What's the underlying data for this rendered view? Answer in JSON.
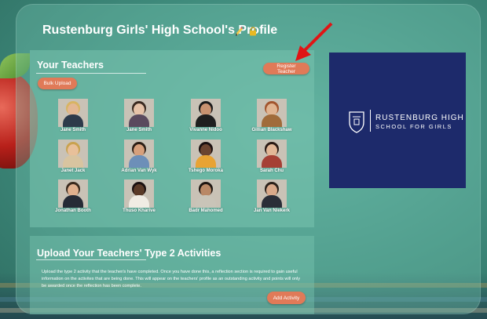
{
  "header": {
    "school_title": "Rustenburg Girls' High School's Profile",
    "icons": [
      "pencil-icon",
      "lock-icon"
    ]
  },
  "teachers": {
    "heading": "Your Teachers",
    "bulk_upload_label": "Bulk Upload",
    "register_label": "Register Teacher",
    "list": [
      {
        "name": "Jane Smith",
        "skin": "#e3b793",
        "shirt": "#2d3a4a",
        "hair": "#d8b463"
      },
      {
        "name": "Jane Smith",
        "skin": "#e6c3a8",
        "shirt": "#5a4a5e",
        "hair": "#3a2a20"
      },
      {
        "name": "Vivanne Nidoo",
        "skin": "#c89270",
        "shirt": "#1f1f1f",
        "hair": "#1a1a1a"
      },
      {
        "name": "Gillian Blackshaw",
        "skin": "#e1b592",
        "shirt": "#a06b3a",
        "hair": "#a2552e"
      },
      {
        "name": "Janet Jack",
        "skin": "#e8c09a",
        "shirt": "#d8c4a0",
        "hair": "#c9a24f"
      },
      {
        "name": "Adrian Van Wyk",
        "skin": "#d7a07c",
        "shirt": "#6d8fb8",
        "hair": "#2c1e15"
      },
      {
        "name": "Tshego Moroka",
        "skin": "#6b4430",
        "shirt": "#e8a334",
        "hair": "#1a1010"
      },
      {
        "name": "Sarah Chu",
        "skin": "#e2b797",
        "shirt": "#a54035",
        "hair": "#2a1a14"
      },
      {
        "name": "Jonathan Booth",
        "skin": "#e0b08e",
        "shirt": "#262b36",
        "hair": "#3a2a1e"
      },
      {
        "name": "Thuso Kharive",
        "skin": "#5a3a28",
        "shirt": "#f0ece4",
        "hair": "#1a1010"
      },
      {
        "name": "Badr Mahomed",
        "skin": "#b98866",
        "shirt": "#c9c4b8",
        "hair": "#1e1612"
      },
      {
        "name": "Jan Van Niekerk",
        "skin": "#d9a98a",
        "shirt": "#2a2e38",
        "hair": "#2b211a"
      }
    ]
  },
  "logo": {
    "line1": "RUSTENBURG HIGH",
    "line2": "SCHOOL FOR GIRLS",
    "bg_color": "#1d2a6b"
  },
  "activities": {
    "heading": "Upload Your Teachers' Type 2 Activities",
    "description": "Upload the type 2 activity that the teacher/s have completed. Once you have done this, a reflection section is required to gain useful information on the activites that are being done. This will appear on the teachers' profile as an outstanding activity and points will only be awarded once the reflection has been complete.",
    "add_label": "Add Activity"
  },
  "colors": {
    "accent_button": "#e07a58",
    "arrow": "#e01515"
  }
}
